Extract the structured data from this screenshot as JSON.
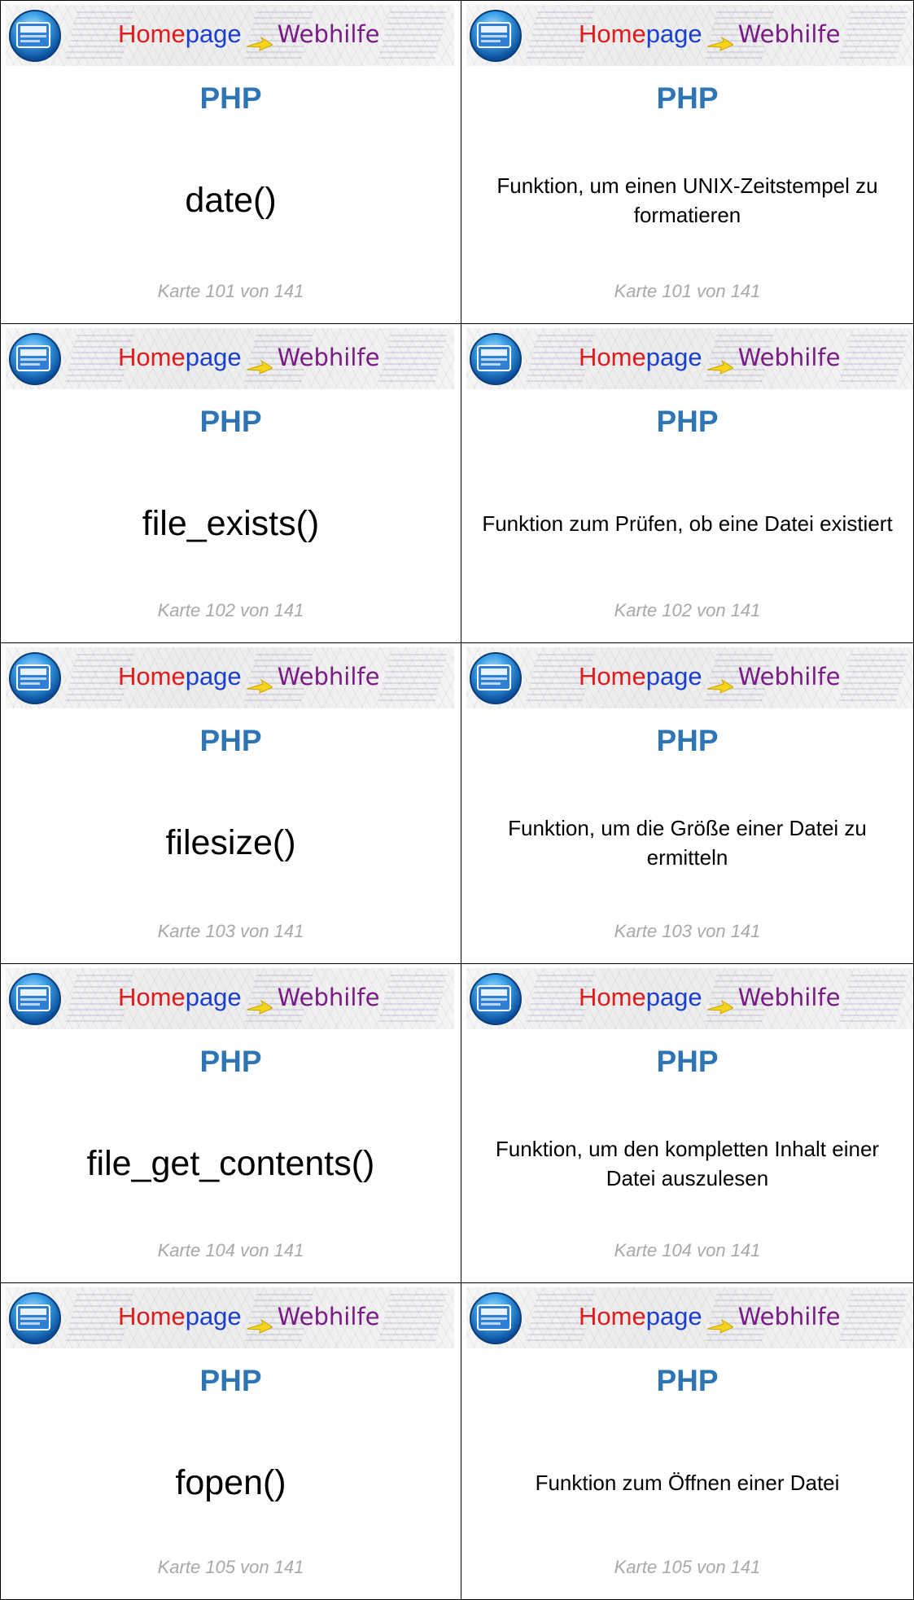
{
  "brand": {
    "home": "Home",
    "page": "page",
    "web": "Webhilfe"
  },
  "colors": {
    "title": "#2e75b6",
    "footer": "#a8a8a8",
    "home": "#e11b1b",
    "page": "#1a3fd0",
    "web": "#7a1a86"
  },
  "cards": [
    {
      "front": {
        "category": "PHP",
        "term": "date()",
        "footer": "Karte 101 von 141"
      },
      "back": {
        "category": "PHP",
        "description": "Funktion, um einen UNIX-Zeitstempel zu formatieren",
        "footer": "Karte 101 von 141"
      }
    },
    {
      "front": {
        "category": "PHP",
        "term": "file_exists()",
        "footer": "Karte 102 von 141"
      },
      "back": {
        "category": "PHP",
        "description": "Funktion zum Prüfen, ob eine Datei existiert",
        "footer": "Karte 102 von 141"
      }
    },
    {
      "front": {
        "category": "PHP",
        "term": "filesize()",
        "footer": "Karte 103 von 141"
      },
      "back": {
        "category": "PHP",
        "description": "Funktion, um die Größe einer Datei zu ermitteln",
        "footer": "Karte 103 von 141"
      }
    },
    {
      "front": {
        "category": "PHP",
        "term": "file_get_contents()",
        "footer": "Karte 104 von 141"
      },
      "back": {
        "category": "PHP",
        "description": "Funktion, um den kompletten Inhalt einer Datei auszulesen",
        "footer": "Karte 104 von 141"
      }
    },
    {
      "front": {
        "category": "PHP",
        "term": "fopen()",
        "footer": "Karte 105 von 141"
      },
      "back": {
        "category": "PHP",
        "description": "Funktion zum Öffnen einer Datei",
        "footer": "Karte 105 von 141"
      }
    }
  ]
}
